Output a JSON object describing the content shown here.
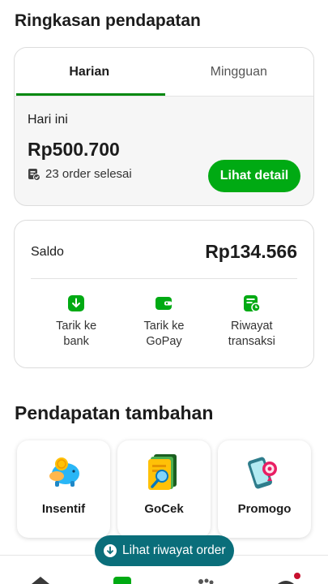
{
  "summary": {
    "title": "Ringkasan pendapatan",
    "tabs": [
      {
        "label": "Harian",
        "active": true
      },
      {
        "label": "Mingguan",
        "active": false
      }
    ],
    "today_label": "Hari ini",
    "today_amount": "Rp500.700",
    "orders_done": "23 order selesai",
    "detail_button": "Lihat detail"
  },
  "balance": {
    "label": "Saldo",
    "amount": "Rp134.566",
    "actions": [
      {
        "icon": "withdraw-bank-icon",
        "line1": "Tarik ke",
        "line2": "bank"
      },
      {
        "icon": "wallet-icon",
        "line1": "Tarik ke",
        "line2": "GoPay"
      },
      {
        "icon": "transaction-history-icon",
        "line1": "Riwayat",
        "line2": "transaksi"
      }
    ]
  },
  "extra_income": {
    "title": "Pendapatan tambahan",
    "tiles": [
      {
        "icon": "incentive-piggy-icon",
        "label": "Insentif"
      },
      {
        "icon": "gocek-document-icon",
        "label": "GoCek"
      },
      {
        "icon": "promogo-phone-icon",
        "label": "Promogo"
      }
    ]
  },
  "order_history_button": "Lihat riwayat order",
  "colors": {
    "brand_green": "#00AA13",
    "tab_indicator": "#00880F",
    "pill_teal": "#0A6E7A",
    "notification_dot": "#C8102E"
  }
}
